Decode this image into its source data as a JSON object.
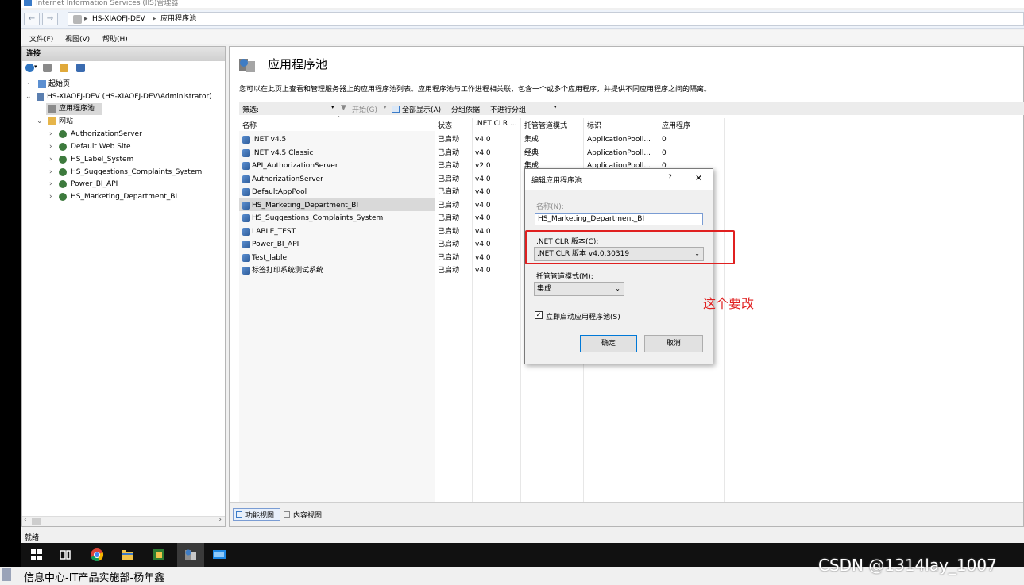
{
  "window": {
    "title": "Internet Information Services (IIS)管理器"
  },
  "address": {
    "crumbs": [
      "HS-XIAOFJ-DEV",
      "应用程序池"
    ]
  },
  "menu": [
    "文件(F)",
    "视图(V)",
    "帮助(H)"
  ],
  "left": {
    "header": "连接",
    "tree": [
      {
        "label": "起始页"
      },
      {
        "label": "HS-XIAOFJ-DEV (HS-XIAOFJ-DEV\\Administrator)"
      },
      {
        "label": "应用程序池"
      },
      {
        "label": "网站"
      },
      {
        "label": "AuthorizationServer"
      },
      {
        "label": "Default Web Site"
      },
      {
        "label": "HS_Label_System"
      },
      {
        "label": "HS_Suggestions_Complaints_System"
      },
      {
        "label": "Power_BI_API"
      },
      {
        "label": "HS_Marketing_Department_BI"
      }
    ]
  },
  "main": {
    "title": "应用程序池",
    "description": "您可以在此页上查看和管理服务器上的应用程序池列表。应用程序池与工作进程相关联，包含一个或多个应用程序，并提供不同应用程序之间的隔离。",
    "filter": {
      "label": "筛选:",
      "go": "开始(G)",
      "showall": "全部显示(A)",
      "groupby": "分组依据:",
      "group_value": "不进行分组"
    },
    "columns": [
      "名称",
      "状态",
      ".NET CLR ...",
      "托管管道模式",
      "标识",
      "应用程序"
    ],
    "rows": [
      {
        "name": ".NET v4.5",
        "status": "已启动",
        "clr": "v4.0",
        "mode": "集成",
        "identity": "ApplicationPooll...",
        "apps": "0"
      },
      {
        "name": ".NET v4.5 Classic",
        "status": "已启动",
        "clr": "v4.0",
        "mode": "经典",
        "identity": "ApplicationPooll...",
        "apps": "0"
      },
      {
        "name": "API_AuthorizationServer",
        "status": "已启动",
        "clr": "v2.0",
        "mode": "集成",
        "identity": "ApplicationPooll...",
        "apps": "0"
      },
      {
        "name": "AuthorizationServer",
        "status": "已启动",
        "clr": "v4.0",
        "mode": "",
        "identity": "",
        "apps": ""
      },
      {
        "name": "DefaultAppPool",
        "status": "已启动",
        "clr": "v4.0",
        "mode": "",
        "identity": "",
        "apps": ""
      },
      {
        "name": "HS_Marketing_Department_BI",
        "status": "已启动",
        "clr": "v4.0",
        "mode": "",
        "identity": "",
        "apps": ""
      },
      {
        "name": "HS_Suggestions_Complaints_System",
        "status": "已启动",
        "clr": "v4.0",
        "mode": "",
        "identity": "",
        "apps": ""
      },
      {
        "name": "LABLE_TEST",
        "status": "已启动",
        "clr": "v4.0",
        "mode": "",
        "identity": "",
        "apps": ""
      },
      {
        "name": "Power_BI_API",
        "status": "已启动",
        "clr": "v4.0",
        "mode": "",
        "identity": "",
        "apps": ""
      },
      {
        "name": "Test_lable",
        "status": "已启动",
        "clr": "v4.0",
        "mode": "",
        "identity": "",
        "apps": ""
      },
      {
        "name": "标签打印系统测试系统",
        "status": "已启动",
        "clr": "v4.0",
        "mode": "",
        "identity": "",
        "apps": ""
      }
    ],
    "tabs": [
      "功能视图",
      "内容视图"
    ]
  },
  "status": "就绪",
  "dialog": {
    "title": "编辑应用程序池",
    "help": "?",
    "close": "✕",
    "name_label": "名称(N):",
    "name_value": "HS_Marketing_Department_BI",
    "clr_label": ".NET CLR 版本(C):",
    "clr_value": ".NET CLR 版本 v4.0.30319",
    "mode_label": "托管管道模式(M):",
    "mode_value": "集成",
    "autostart_label": "立即启动应用程序池(S)",
    "autostart_checked": true,
    "ok": "确定",
    "cancel": "取消"
  },
  "annotation": {
    "note": "这个要改",
    "color": "#e02020"
  },
  "bottom": {
    "left_text": "信息中心-IT产品实施部-杨年鑫",
    "watermark": "CSDN @1314lay_1007"
  }
}
